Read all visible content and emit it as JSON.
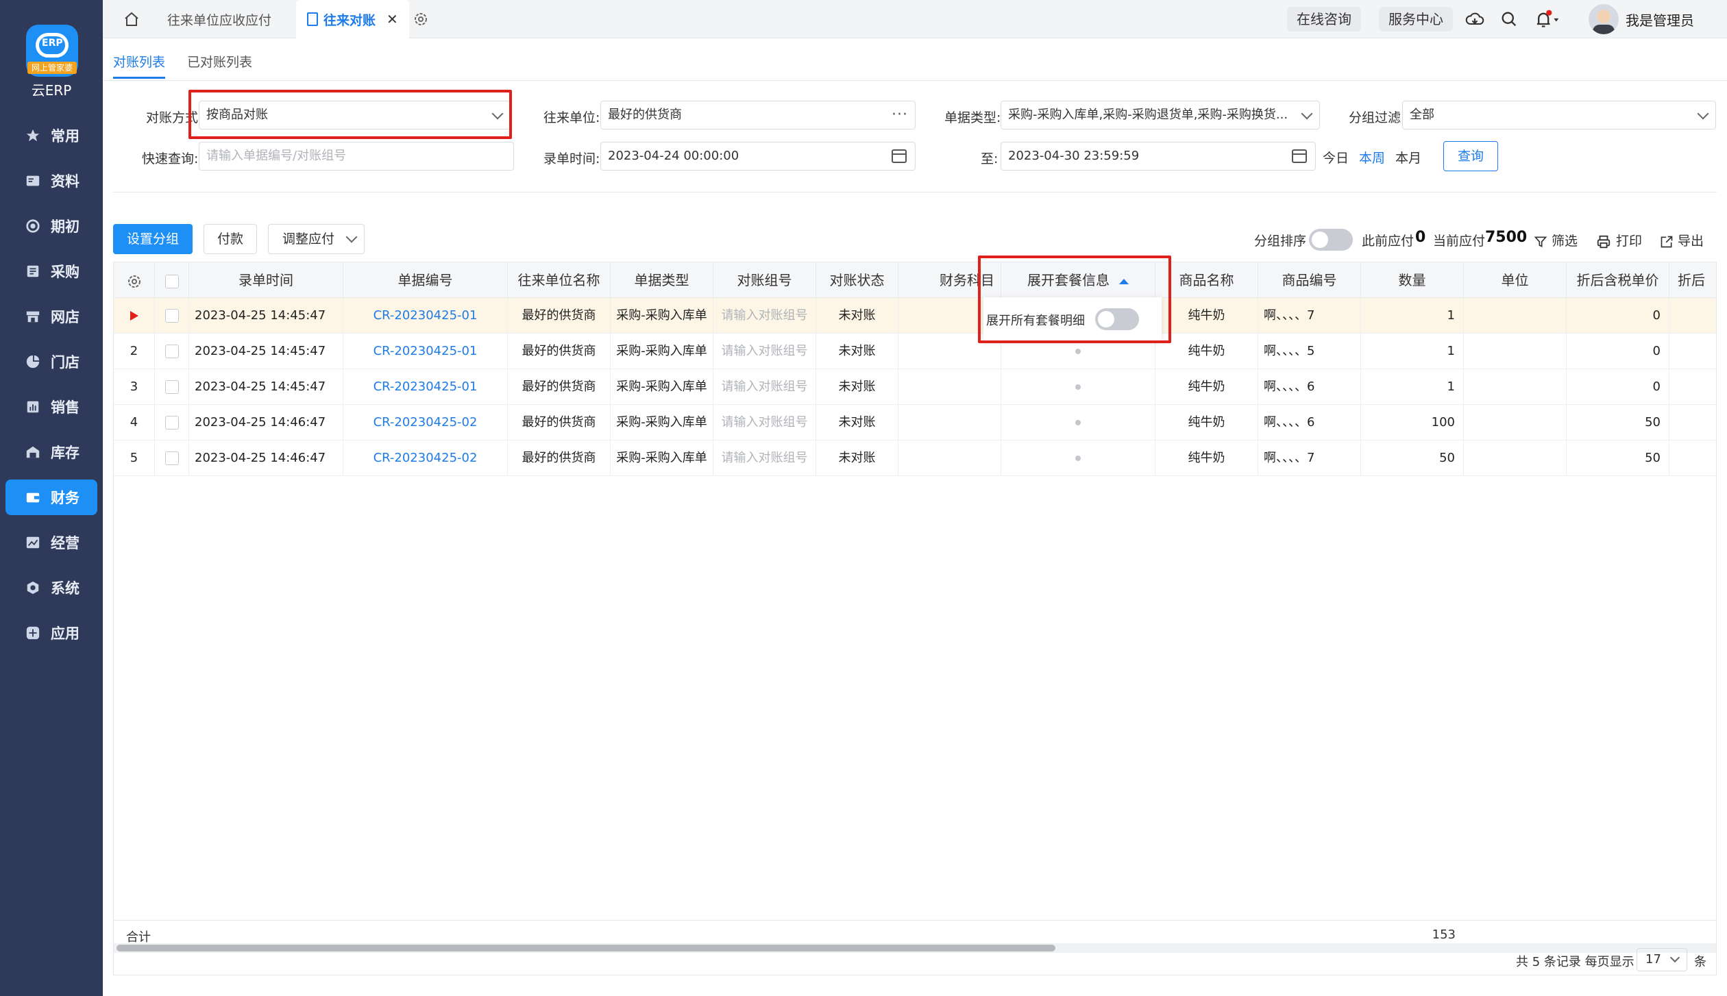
{
  "sidebar": {
    "logo_badge": "网上管家婆",
    "logo_text": "云ERP",
    "items": [
      {
        "label": "常用",
        "icon": "star-icon"
      },
      {
        "label": "资料",
        "icon": "id-card-icon"
      },
      {
        "label": "期初",
        "icon": "target-icon"
      },
      {
        "label": "采购",
        "icon": "list-icon"
      },
      {
        "label": "网店",
        "icon": "store-icon"
      },
      {
        "label": "门店",
        "icon": "pie-icon"
      },
      {
        "label": "销售",
        "icon": "chart-icon"
      },
      {
        "label": "库存",
        "icon": "warehouse-icon"
      },
      {
        "label": "财务",
        "icon": "wallet-icon",
        "active": true
      },
      {
        "label": "经营",
        "icon": "image-icon"
      },
      {
        "label": "系统",
        "icon": "settings-hex-icon"
      },
      {
        "label": "应用",
        "icon": "plus-square-icon"
      }
    ]
  },
  "topbar": {
    "tabs": [
      {
        "label": "往来单位应收应付",
        "active": false
      },
      {
        "label": "往来对账",
        "active": true
      }
    ],
    "buttons": [
      "在线咨询",
      "服务中心"
    ],
    "user_name": "我是管理员"
  },
  "subtabs": [
    {
      "label": "对账列表",
      "active": true
    },
    {
      "label": "已对账列表",
      "active": false
    }
  ],
  "filters": {
    "mode_label": "对账方式",
    "mode_value": "按商品对账",
    "partner_label": "往来单位:",
    "partner_value": "最好的供货商",
    "doc_type_label": "单据类型:",
    "doc_type_value": "采购-采购入库单,采购-采购退货单,采购-采购换货...",
    "group_filter_label": "分组过滤",
    "group_filter_value": "全部",
    "quick_label": "快速查询:",
    "quick_placeholder": "请输入单据编号/对账组号",
    "time_label": "录单时间:",
    "time_from": "2023-04-24 00:00:00",
    "to_label": "至:",
    "time_to": "2023-04-30 23:59:59",
    "quick_today": "今日",
    "quick_week": "本周",
    "quick_month": "本月",
    "query_button": "查询"
  },
  "actions": {
    "set_group": "设置分组",
    "pay": "付款",
    "adjust": "调整应付",
    "group_sort_label": "分组排序",
    "prev_payable_label": "此前应付",
    "prev_payable_value": "0",
    "current_payable_label": "当前应付",
    "current_payable_value": "7500",
    "filter": "筛选",
    "print": "打印",
    "export": "导出"
  },
  "table": {
    "columns": [
      "录单时间",
      "单据编号",
      "往来单位名称",
      "单据类型",
      "对账组号",
      "对账状态",
      "财务科目",
      "展开套餐信息",
      "商品名称",
      "商品编号",
      "数量",
      "单位",
      "折后含税单价",
      "折后"
    ],
    "popover_label": "展开所有套餐明细",
    "rows": [
      {
        "no": "",
        "time": "2023-04-25 14:45:47",
        "doc_no": "CR-20230425-01",
        "partner": "最好的供货商",
        "type": "采购-采购入库单",
        "group_no": "请输入对账组号",
        "status": "未对账",
        "product": "纯牛奶",
        "code": "啊、、、、7",
        "qty": "1",
        "price": "0"
      },
      {
        "no": "2",
        "time": "2023-04-25 14:45:47",
        "doc_no": "CR-20230425-01",
        "partner": "最好的供货商",
        "type": "采购-采购入库单",
        "group_no": "请输入对账组号",
        "status": "未对账",
        "product": "纯牛奶",
        "code": "啊、、、、5",
        "qty": "1",
        "price": "0"
      },
      {
        "no": "3",
        "time": "2023-04-25 14:45:47",
        "doc_no": "CR-20230425-01",
        "partner": "最好的供货商",
        "type": "采购-采购入库单",
        "group_no": "请输入对账组号",
        "status": "未对账",
        "product": "纯牛奶",
        "code": "啊、、、、6",
        "qty": "1",
        "price": "0"
      },
      {
        "no": "4",
        "time": "2023-04-25 14:46:47",
        "doc_no": "CR-20230425-02",
        "partner": "最好的供货商",
        "type": "采购-采购入库单",
        "group_no": "请输入对账组号",
        "status": "未对账",
        "product": "纯牛奶",
        "code": "啊、、、、6",
        "qty": "100",
        "price": "50"
      },
      {
        "no": "5",
        "time": "2023-04-25 14:46:47",
        "doc_no": "CR-20230425-02",
        "partner": "最好的供货商",
        "type": "采购-采购入库单",
        "group_no": "请输入对账组号",
        "status": "未对账",
        "product": "纯牛奶",
        "code": "啊、、、、7",
        "qty": "50",
        "price": "50"
      }
    ],
    "total_label": "合计",
    "total_qty": "153"
  },
  "pager": {
    "summary": "共 5 条记录  每页显示",
    "page_size": "17",
    "unit": "条"
  },
  "colors": {
    "sidebar_bg": "#2f3a5a",
    "accent": "#1e8ff5",
    "highlight_box": "#e0201b",
    "selected_row": "#fdf6e6"
  }
}
